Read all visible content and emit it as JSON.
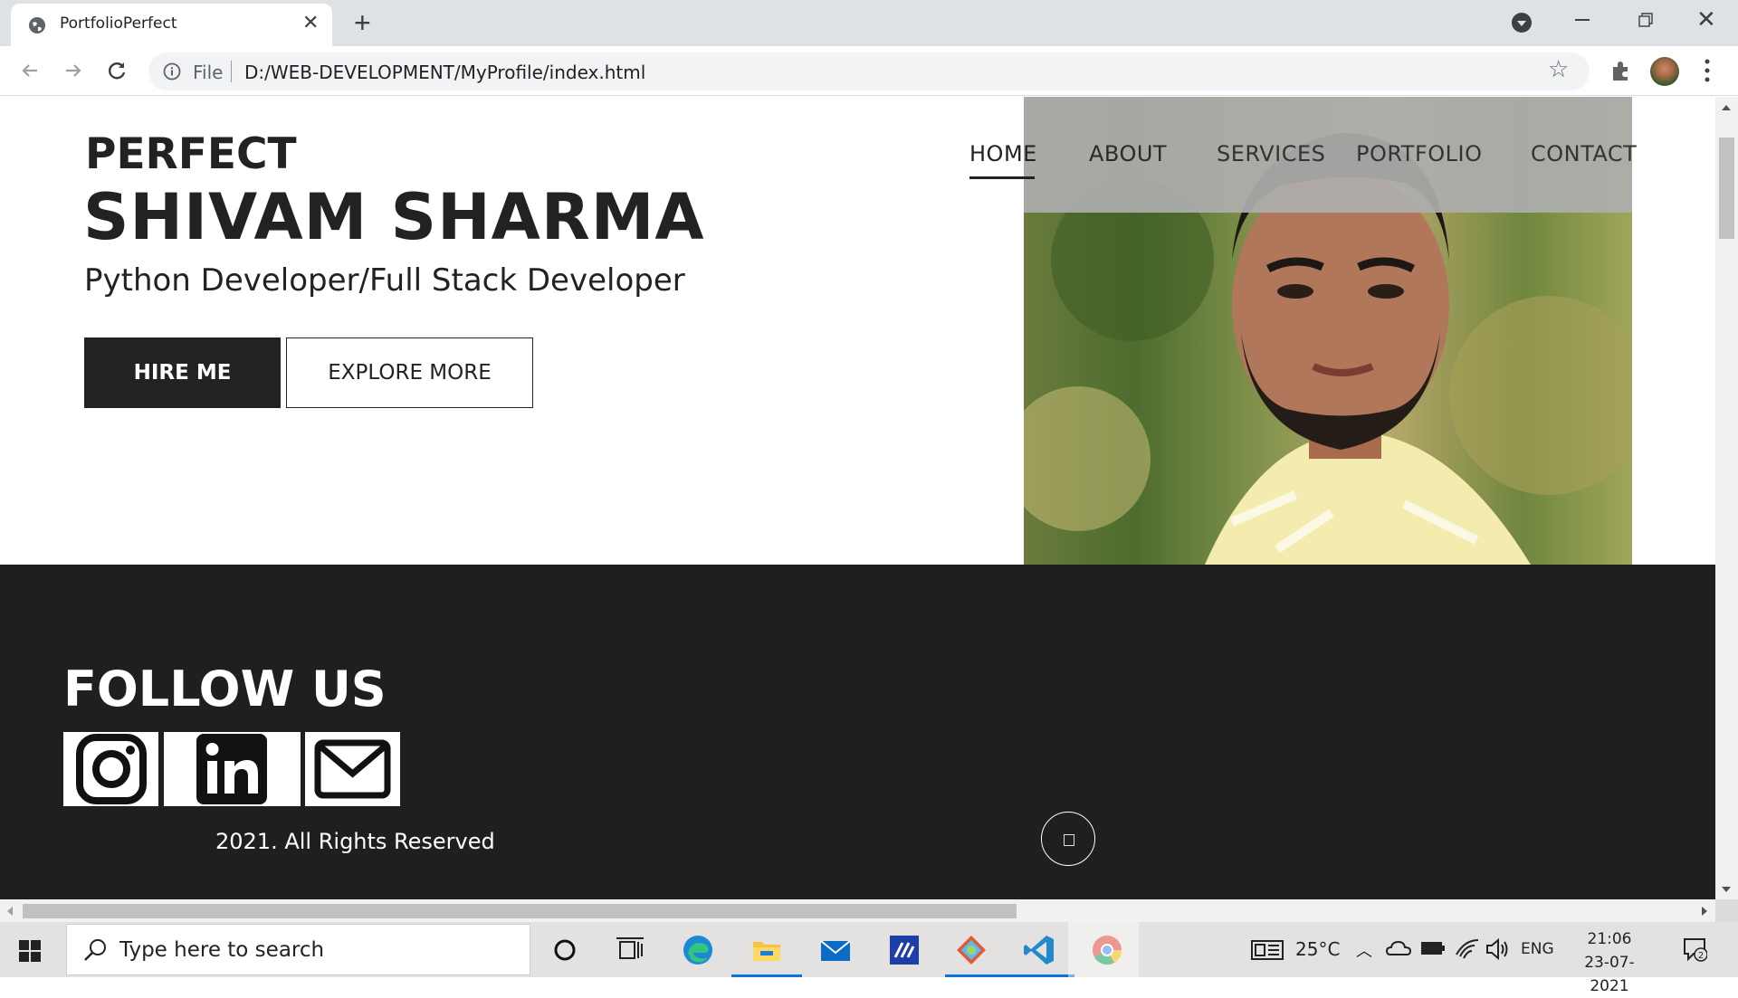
{
  "browser": {
    "tab_title": "PortfolioPerfect",
    "file_label": "File",
    "url": "D:/WEB-DEVELOPMENT/MyProfile/index.html"
  },
  "site": {
    "logo": "PERFECT",
    "nav": [
      "HOME",
      "ABOUT",
      "SERVICES",
      "PORTFOLIO",
      "CONTACT"
    ],
    "active_nav": "HOME",
    "hero_name": "SHIVAM SHARMA",
    "hero_role": "Python Developer/Full Stack Developer",
    "hire_label": "HIRE ME",
    "explore_label": "EXPLORE MORE",
    "follow_title": "FOLLOW US",
    "social": [
      "instagram-icon",
      "linkedin-icon",
      "mail-icon"
    ],
    "rights": "2021. All Rights Reserved"
  },
  "taskbar": {
    "search_placeholder": "Type here to search",
    "weather": "25°C",
    "lang": "ENG",
    "time": "21:06",
    "date": "23-07-2021",
    "notifications": "2",
    "accent": "#0a74d8"
  }
}
